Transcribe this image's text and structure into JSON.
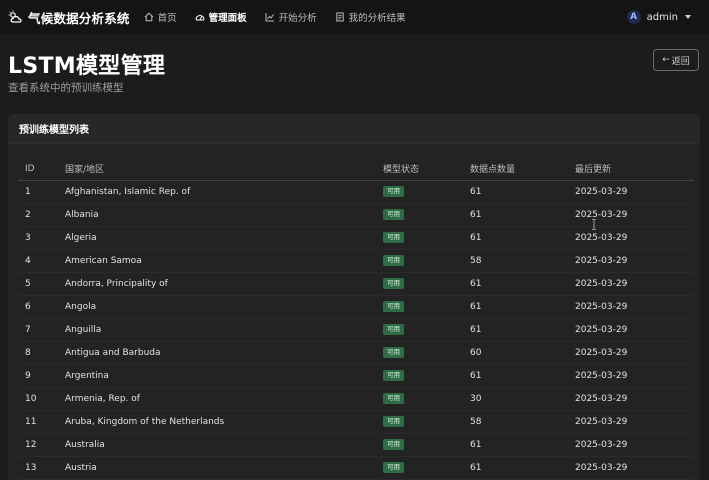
{
  "navbar": {
    "brand": "气候数据分析系统",
    "items": [
      {
        "label": "首页",
        "icon": "home-icon"
      },
      {
        "label": "管理面板",
        "icon": "dashboard-icon"
      },
      {
        "label": "开始分析",
        "icon": "chart-line-icon"
      },
      {
        "label": "我的分析结果",
        "icon": "document-icon"
      }
    ],
    "active_index": 1,
    "user": {
      "initial": "A",
      "name": "admin"
    }
  },
  "page": {
    "title": "LSTM模型管理",
    "subtitle": "查看系统中的预训练模型",
    "back_label": "返回",
    "back_arrow": "←"
  },
  "card": {
    "title": "预训练模型列表"
  },
  "table": {
    "headers": [
      "ID",
      "国家/地区",
      "模型状态",
      "数据点数量",
      "最后更新"
    ],
    "rows": [
      {
        "id": "1",
        "country": "Afghanistan, Islamic Rep. of",
        "status": "可用",
        "points": "61",
        "updated": "2025-03-29"
      },
      {
        "id": "2",
        "country": "Albania",
        "status": "可用",
        "points": "61",
        "updated": "2025-03-29"
      },
      {
        "id": "3",
        "country": "Algeria",
        "status": "可用",
        "points": "61",
        "updated": "2025-03-29"
      },
      {
        "id": "4",
        "country": "American Samoa",
        "status": "可用",
        "points": "58",
        "updated": "2025-03-29"
      },
      {
        "id": "5",
        "country": "Andorra, Principality of",
        "status": "可用",
        "points": "61",
        "updated": "2025-03-29"
      },
      {
        "id": "6",
        "country": "Angola",
        "status": "可用",
        "points": "61",
        "updated": "2025-03-29"
      },
      {
        "id": "7",
        "country": "Anguilla",
        "status": "可用",
        "points": "61",
        "updated": "2025-03-29"
      },
      {
        "id": "8",
        "country": "Antigua and Barbuda",
        "status": "可用",
        "points": "60",
        "updated": "2025-03-29"
      },
      {
        "id": "9",
        "country": "Argentina",
        "status": "可用",
        "points": "61",
        "updated": "2025-03-29"
      },
      {
        "id": "10",
        "country": "Armenia, Rep. of",
        "status": "可用",
        "points": "30",
        "updated": "2025-03-29"
      },
      {
        "id": "11",
        "country": "Aruba, Kingdom of the Netherlands",
        "status": "可用",
        "points": "58",
        "updated": "2025-03-29"
      },
      {
        "id": "12",
        "country": "Australia",
        "status": "可用",
        "points": "61",
        "updated": "2025-03-29"
      },
      {
        "id": "13",
        "country": "Austria",
        "status": "可用",
        "points": "61",
        "updated": "2025-03-29"
      }
    ]
  },
  "colors": {
    "background": "#1c1c1c",
    "navbar": "#141414",
    "card": "#232323",
    "badge": "#2f6b45"
  }
}
